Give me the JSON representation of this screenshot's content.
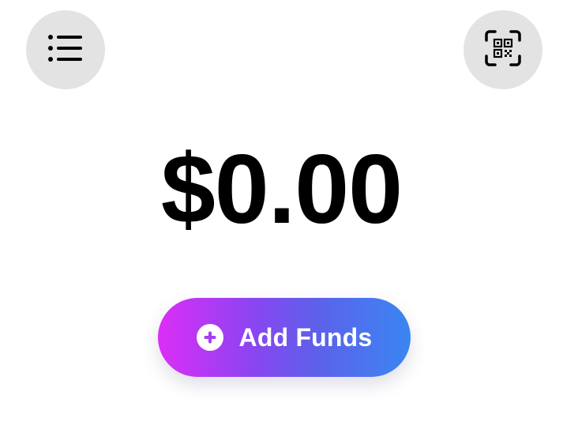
{
  "header": {
    "menu_icon": "list-icon",
    "scan_icon": "qr-scan-icon"
  },
  "balance": {
    "amount": "$0.00"
  },
  "actions": {
    "add_funds_label": "Add Funds",
    "add_funds_icon": "plus-circle-icon"
  },
  "colors": {
    "button_bg": "#e3e3e3",
    "gradient_start": "#db2ef6",
    "gradient_end": "#3a86f2",
    "text": "#000000"
  }
}
